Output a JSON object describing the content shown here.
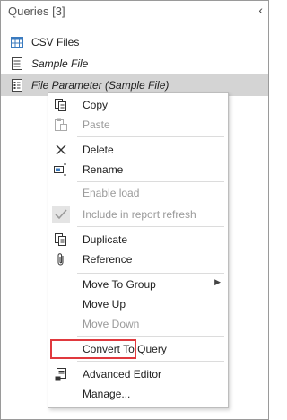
{
  "pane": {
    "title": "Queries [3]",
    "collapse_icon": "chevron-left-icon"
  },
  "queries": [
    {
      "label": "CSV Files",
      "icon": "table-icon",
      "italic": false,
      "selected": false
    },
    {
      "label": "Sample File",
      "icon": "document-icon",
      "italic": true,
      "selected": false
    },
    {
      "label": "File Parameter (Sample File)",
      "icon": "parameter-icon",
      "italic": true,
      "selected": true
    }
  ],
  "menu": {
    "copy": "Copy",
    "paste": "Paste",
    "delete": "Delete",
    "rename": "Rename",
    "enable_load": "Enable load",
    "include_refresh": "Include in report refresh",
    "duplicate": "Duplicate",
    "reference": "Reference",
    "move_to_group": "Move To Group",
    "move_up": "Move Up",
    "move_down": "Move Down",
    "convert_to_query": "Convert To Query",
    "advanced_editor": "Advanced Editor",
    "manage": "Manage..."
  },
  "colors": {
    "selected_row": "#d4d4d4",
    "highlight": "#e0393e",
    "table_icon": "#3b7bbf"
  }
}
